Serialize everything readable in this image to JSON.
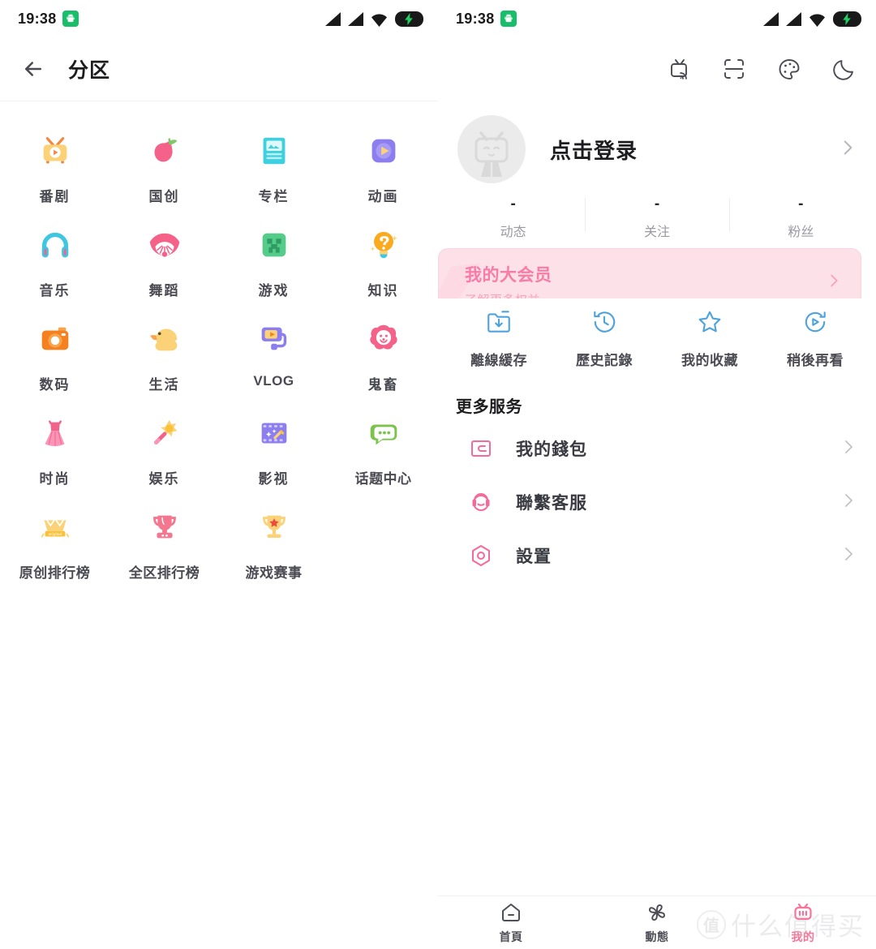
{
  "status_bar": {
    "time": "19:38",
    "android_icon": "android-icon",
    "signal_icon": "signal-bars-icon",
    "wifi_icon": "wifi-icon",
    "battery_icon": "battery-charging-icon"
  },
  "left_panel": {
    "header": {
      "back_icon": "back-arrow-icon",
      "title": "分区"
    },
    "categories": [
      {
        "label": "番剧",
        "icon": "tv-bangumi-icon"
      },
      {
        "label": "国创",
        "icon": "peach-guochuang-icon"
      },
      {
        "label": "专栏",
        "icon": "article-column-icon"
      },
      {
        "label": "动画",
        "icon": "play-animation-icon"
      },
      {
        "label": "音乐",
        "icon": "headphones-music-icon"
      },
      {
        "label": "舞蹈",
        "icon": "fan-dance-icon"
      },
      {
        "label": "游戏",
        "icon": "creeper-game-icon"
      },
      {
        "label": "知识",
        "icon": "lightbulb-knowledge-icon"
      },
      {
        "label": "数码",
        "icon": "camera-digital-icon"
      },
      {
        "label": "生活",
        "icon": "duck-life-icon"
      },
      {
        "label": "VLOG",
        "icon": "camera-rig-vlog-icon"
      },
      {
        "label": "鬼畜",
        "icon": "clown-kichiku-icon"
      },
      {
        "label": "时尚",
        "icon": "dress-fashion-icon"
      },
      {
        "label": "娱乐",
        "icon": "star-wand-entertainment-icon"
      },
      {
        "label": "影视",
        "icon": "film-cinema-icon"
      },
      {
        "label": "话题中心",
        "icon": "chat-bubble-topic-icon"
      },
      {
        "label": "原创排行榜",
        "icon": "original-crown-rank-icon"
      },
      {
        "label": "全区排行榜",
        "icon": "trophy-pink-rank-icon"
      },
      {
        "label": "游戏赛事",
        "icon": "trophy-star-esports-icon"
      }
    ]
  },
  "right_panel": {
    "header_icons": [
      {
        "name": "tv-cast-icon"
      },
      {
        "name": "scan-qr-icon"
      },
      {
        "name": "theme-palette-icon"
      },
      {
        "name": "night-mode-moon-icon"
      }
    ],
    "profile": {
      "avatar_icon": "default-avatar-tv-icon",
      "login_text": "点击登录",
      "chevron_icon": "chevron-right-icon"
    },
    "stats": [
      {
        "value": "-",
        "label": "动态"
      },
      {
        "value": "-",
        "label": "关注"
      },
      {
        "value": "-",
        "label": "粉丝"
      }
    ],
    "vip_banner": {
      "title": "我的大会员",
      "subtitle": "了解更多权益",
      "chevron_icon": "chevron-right-icon",
      "bg_color": "#fce1e9",
      "accent_color": "#f87ca5"
    },
    "quick_actions": [
      {
        "label": "離線緩存",
        "icon": "download-folder-icon"
      },
      {
        "label": "歷史記錄",
        "icon": "clock-history-icon"
      },
      {
        "label": "我的收藏",
        "icon": "star-favorite-icon"
      },
      {
        "label": "稍後再看",
        "icon": "watch-later-icon"
      }
    ],
    "more_services": {
      "title": "更多服务",
      "items": [
        {
          "label": "我的錢包",
          "icon": "wallet-icon",
          "chevron_icon": "chevron-right-icon"
        },
        {
          "label": "聯繫客服",
          "icon": "headset-support-icon",
          "chevron_icon": "chevron-right-icon"
        },
        {
          "label": "設置",
          "icon": "settings-gear-icon",
          "chevron_icon": "chevron-right-icon"
        }
      ],
      "icon_color": "#f56a96"
    },
    "bottom_nav": [
      {
        "label": "首頁",
        "icon": "home-icon",
        "active": false
      },
      {
        "label": "動態",
        "icon": "pinwheel-icon",
        "active": false
      },
      {
        "label": "我的",
        "icon": "tv-profile-icon",
        "active": true
      }
    ],
    "active_color": "#fb7299",
    "quick_icon_color": "#4fa3dd"
  },
  "watermark": {
    "badge": "值",
    "text": "什么值得买"
  }
}
